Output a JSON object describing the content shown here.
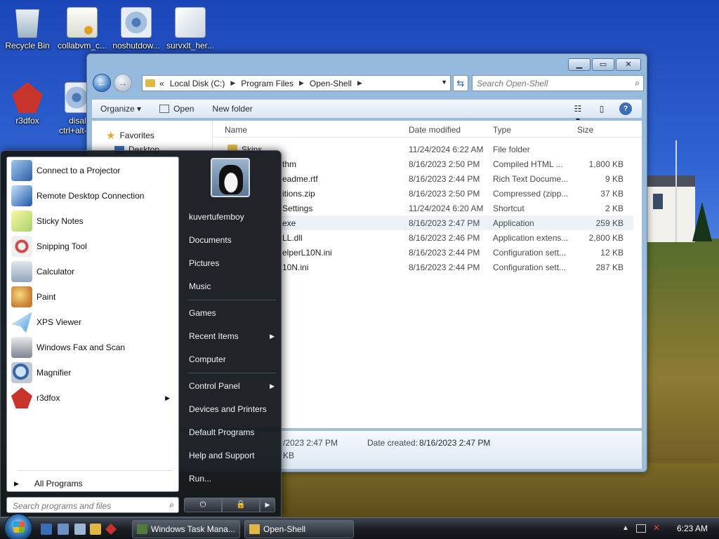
{
  "colors": {
    "accent": "#3b78c4",
    "start_menu_bg": "#14181e",
    "taskbar_bg": "#1b1f25",
    "folder": "#e6bc4f"
  },
  "desktop": {
    "icons": [
      {
        "label": "Recycle Bin",
        "icon": "recycle-bin-icon"
      },
      {
        "label": "collabvm_c...",
        "icon": "certificate-icon"
      },
      {
        "label": "noshutdow...",
        "icon": "settings-file-icon"
      },
      {
        "label": "survxlt_her...",
        "icon": "document-icon"
      },
      {
        "label": "r3dfox",
        "icon": "r3dfox-icon"
      },
      {
        "label": "disal",
        "icon": "settings-file-icon"
      },
      {
        "label": "ctrl+alt-",
        "icon": "settings-file-icon"
      }
    ]
  },
  "explorer": {
    "window_controls": {
      "minimize": "▁",
      "maximize": "▭",
      "close": "✕"
    },
    "breadcrumb": {
      "prefix": "«",
      "items": [
        "Local Disk (C:)",
        "Program Files",
        "Open-Shell"
      ]
    },
    "search_placeholder": "Search Open-Shell",
    "toolbar": {
      "organize": "Organize ▾",
      "open": "Open",
      "new_folder": "New folder"
    },
    "nav_pane": {
      "favorites": "Favorites",
      "desktop": "Desktop"
    },
    "columns": {
      "name": "Name",
      "date": "Date modified",
      "type": "Type",
      "size": "Size"
    },
    "rows": [
      {
        "name": "Skins",
        "date": "11/24/2024 6:22 AM",
        "type": "File folder",
        "size": "",
        "folder": true
      },
      {
        "name": "thm",
        "date": "8/16/2023 2:50 PM",
        "type": "Compiled HTML ...",
        "size": "1,800 KB"
      },
      {
        "name": "eadme.rtf",
        "date": "8/16/2023 2:44 PM",
        "type": "Rich Text Docume...",
        "size": "9 KB"
      },
      {
        "name": "itions.zip",
        "date": "8/16/2023 2:50 PM",
        "type": "Compressed (zipp...",
        "size": "37 KB"
      },
      {
        "name": "Settings",
        "date": "11/24/2024 6:20 AM",
        "type": "Shortcut",
        "size": "2 KB"
      },
      {
        "name": "exe",
        "date": "8/16/2023 2:47 PM",
        "type": "Application",
        "size": "259 KB",
        "selected": true
      },
      {
        "name": "LL.dll",
        "date": "8/16/2023 2:46 PM",
        "type": "Application extens...",
        "size": "2,800 KB"
      },
      {
        "name": "elperL10N.ini",
        "date": "8/16/2023 2:44 PM",
        "type": "Configuration sett...",
        "size": "12 KB"
      },
      {
        "name": "10N.ini",
        "date": "8/16/2023 2:44 PM",
        "type": "Configuration sett...",
        "size": "287 KB"
      }
    ],
    "details": {
      "modified_partial": "/2023 2:47 PM",
      "created_label": "Date created:",
      "created_value": "8/16/2023 2:47 PM",
      "size_partial": "KB"
    }
  },
  "start_menu": {
    "programs": [
      {
        "label": "Connect to a Projector",
        "icon": "projector-icon"
      },
      {
        "label": "Remote Desktop Connection",
        "icon": "remote-desktop-icon"
      },
      {
        "label": "Sticky Notes",
        "icon": "sticky-notes-icon"
      },
      {
        "label": "Snipping Tool",
        "icon": "snipping-tool-icon"
      },
      {
        "label": "Calculator",
        "icon": "calculator-icon"
      },
      {
        "label": "Paint",
        "icon": "paint-icon"
      },
      {
        "label": "XPS Viewer",
        "icon": "xps-viewer-icon"
      },
      {
        "label": "Windows Fax and Scan",
        "icon": "fax-scan-icon"
      },
      {
        "label": "Magnifier",
        "icon": "magnifier-icon"
      },
      {
        "label": "r3dfox",
        "icon": "r3dfox-icon",
        "submenu": true
      }
    ],
    "all_programs": "All Programs",
    "search_placeholder": "Search programs and files",
    "user": "kuvertufemboy",
    "places": [
      "Documents",
      "Pictures",
      "Music",
      "Games",
      "Recent Items",
      "Computer",
      "Control Panel",
      "Devices and Printers",
      "Default Programs",
      "Help and Support",
      "Run..."
    ],
    "power": {
      "shutdown": "⏻",
      "lock": "🔒",
      "more": "▶"
    }
  },
  "taskbar": {
    "buttons": [
      {
        "label": "Windows Task Mana...",
        "icon": "task-manager-icon"
      },
      {
        "label": "Open-Shell",
        "icon": "folder-icon"
      }
    ],
    "tray": {
      "expand": "▲",
      "network": "network-icon",
      "volume": "volume-muted-icon"
    },
    "clock": "6:23 AM"
  }
}
